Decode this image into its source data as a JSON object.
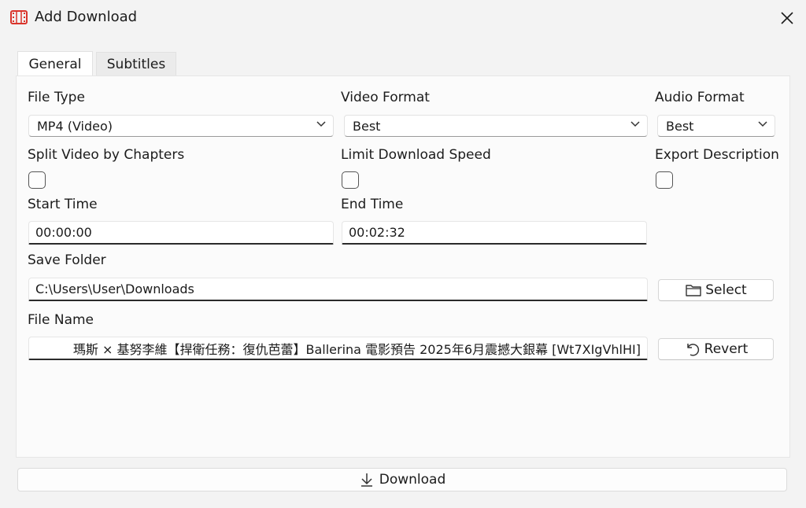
{
  "window": {
    "title": "Add Download",
    "close_glyph": "✕"
  },
  "tabs": [
    {
      "label": "General",
      "active": true
    },
    {
      "label": "Subtitles",
      "active": false
    }
  ],
  "form": {
    "file_type": {
      "label": "File Type",
      "value": "MP4 (Video)"
    },
    "video_format": {
      "label": "Video Format",
      "value": "Best"
    },
    "audio_format": {
      "label": "Audio Format",
      "value": "Best"
    },
    "split_chapters": {
      "label": "Split Video by Chapters",
      "checked": false
    },
    "limit_speed": {
      "label": "Limit Download Speed",
      "checked": false
    },
    "export_description": {
      "label": "Export Description",
      "checked": false
    },
    "start_time": {
      "label": "Start Time",
      "value": "00:00:00"
    },
    "end_time": {
      "label": "End Time",
      "value": "00:02:32"
    },
    "save_folder": {
      "label": "Save Folder",
      "value": "C:\\Users\\User\\Downloads"
    },
    "select_button": "Select",
    "file_name": {
      "label": "File Name",
      "value": "瑪斯 × 基努李維【捍衛任務：復仇芭蕾】Ballerina 電影預告 2025年6月震撼大銀幕 [Wt7XIgVhlHI]"
    },
    "revert_button": "Revert"
  },
  "download_button": "Download",
  "icons": {
    "app": "film-icon",
    "close": "close-icon",
    "chevron": "chevron-down-icon",
    "folder": "folder-icon",
    "revert": "undo-icon",
    "download": "download-arrow-icon"
  },
  "colors": {
    "app_icon": "#d9342b",
    "input_underline": "#2b2b2b"
  }
}
